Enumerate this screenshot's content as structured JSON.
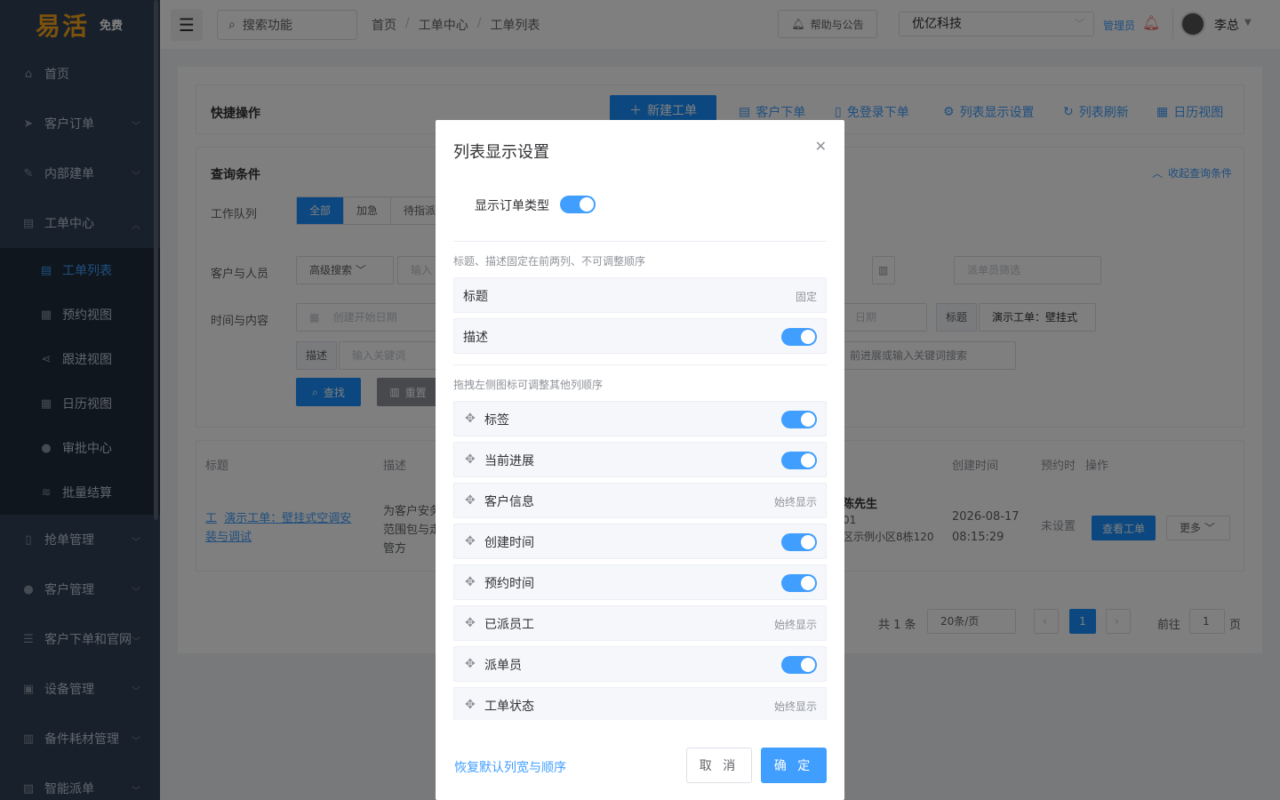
{
  "sidebar": {
    "brand": "易活",
    "brand_tag": "免费",
    "items": [
      {
        "label": "首页"
      },
      {
        "label": "客户订单"
      },
      {
        "label": "内部建单"
      },
      {
        "label": "工单中心"
      }
    ],
    "sub_items": [
      {
        "label": "工单列表"
      },
      {
        "label": "预约视图"
      },
      {
        "label": "跟进视图"
      },
      {
        "label": "日历视图"
      },
      {
        "label": "审批中心"
      },
      {
        "label": "批量结算"
      }
    ],
    "items_after": [
      {
        "label": "抢单管理"
      },
      {
        "label": "客户管理"
      },
      {
        "label": "客户下单和官网"
      },
      {
        "label": "设备管理"
      },
      {
        "label": "备件耗材管理"
      },
      {
        "label": "智能派单"
      }
    ]
  },
  "header": {
    "search_label": "搜索功能",
    "breadcrumb": [
      "首页",
      "工单中心",
      "工单列表"
    ],
    "help_label": "帮助与公告",
    "company": "优亿科技",
    "role": "管理员",
    "user": "李总"
  },
  "page": {
    "quick_title": "快捷操作",
    "new_order": "新建工单",
    "tools": [
      "客户下单",
      "免登录下单",
      "列表显示设置",
      "列表刷新",
      "日历视图"
    ],
    "query_title": "查询条件",
    "collapse": "收起查询条件",
    "queue_label": "工作队列",
    "queue_tabs": [
      "全部",
      "加急",
      "待指派"
    ],
    "people_label": "客户与人员",
    "adv_search": "高级搜索",
    "input_ph": "输入",
    "dispatcher_ph": "派单员筛选",
    "time_label": "时间与内容",
    "start_date_ph": "创建开始日期",
    "end_date_ph": "日期",
    "title_tag": "标题",
    "title_value": "演示工单：壁挂式",
    "desc_tag": "描述",
    "kw_ph": "输入关键词",
    "progress_ph": "前进展或输入关键词搜索",
    "btn_search": "查找",
    "btn_reset": "重置",
    "table_headers": [
      "标题",
      "描述",
      "创建时间",
      "预约时",
      "操作"
    ],
    "row": {
      "title_prefix": "工",
      "title": "演示工单：壁挂式空调安装与调试",
      "desc": "为客户安务范围包与走管方",
      "customer": "陈先生",
      "phone": "01",
      "address": "区示例小区8栋120",
      "created_date": "2026-08-17",
      "created_time": "08:15:29",
      "appoint": "未设置",
      "view_btn": "查看工单",
      "more_btn": "更多"
    },
    "pager": {
      "total": "共 1 条",
      "size": "20条/页",
      "current": "1",
      "goto": "前往",
      "goto_val": "1",
      "page_unit": "页"
    }
  },
  "modal": {
    "title": "列表显示设置",
    "show_type_label": "显示订单类型",
    "hint_fixed": "标题、描述固定在前两列、不可调整顺序",
    "fixed_rows": [
      {
        "label": "标题",
        "note": "固定"
      },
      {
        "label": "描述",
        "note": ""
      }
    ],
    "hint_drag": "拖拽左侧图标可调整其他列顺序",
    "rows": [
      {
        "label": "标签",
        "note": ""
      },
      {
        "label": "当前进展",
        "note": ""
      },
      {
        "label": "客户信息",
        "note": "始终显示"
      },
      {
        "label": "创建时间",
        "note": ""
      },
      {
        "label": "预约时间",
        "note": ""
      },
      {
        "label": "已派员工",
        "note": "始终显示"
      },
      {
        "label": "派单员",
        "note": ""
      },
      {
        "label": "工单状态",
        "note": "始终显示"
      }
    ],
    "reset_link": "恢复默认列宽与顺序",
    "cancel": "取 消",
    "ok": "确 定"
  },
  "colors": {
    "primary": "#409eff",
    "sidebar_bg": "#304156",
    "brand": "#f7a51c",
    "danger": "#f56c6c"
  }
}
